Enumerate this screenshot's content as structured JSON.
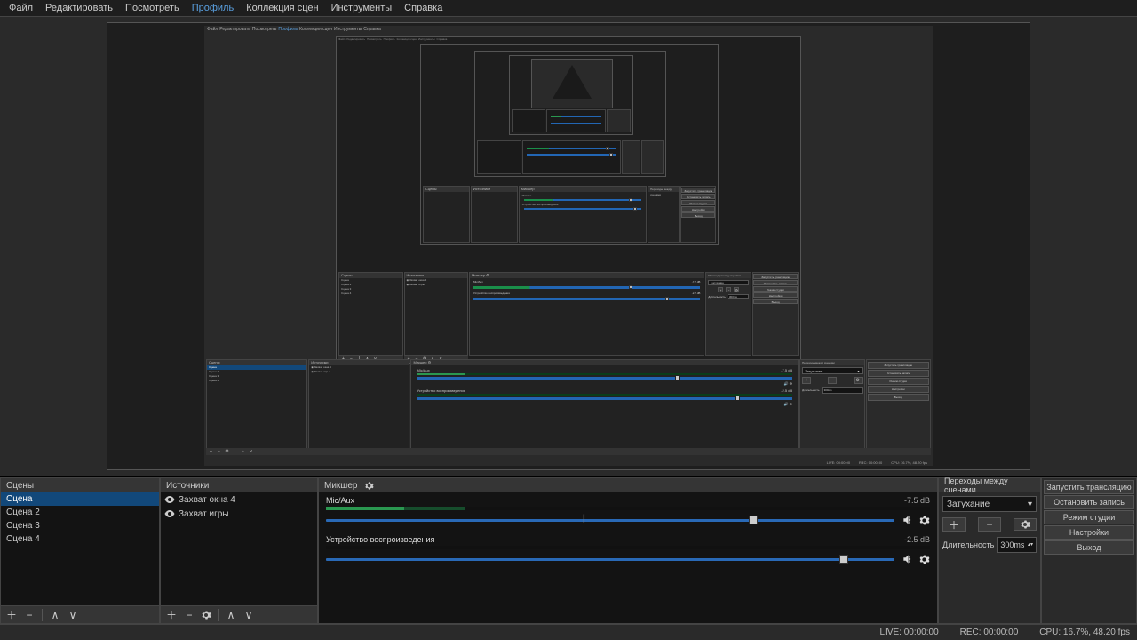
{
  "menu": {
    "file": "Файл",
    "edit": "Редактировать",
    "view": "Посмотреть",
    "profile": "Профиль",
    "scene_collection": "Коллекция сцен",
    "tools": "Инструменты",
    "help": "Справка"
  },
  "docks": {
    "scenes_title": "Сцены",
    "sources_title": "Источники",
    "mixer_title": "Микшер",
    "transitions_title": "Переходы между сценами"
  },
  "scenes": {
    "items": [
      "Сцена",
      "Сцена 2",
      "Сцена 3",
      "Сцена 4"
    ],
    "selected": 0
  },
  "sources": {
    "items": [
      {
        "name": "Захват окна 4",
        "visible": true
      },
      {
        "name": "Захват игры",
        "visible": true
      }
    ]
  },
  "mixer": {
    "channels": [
      {
        "name": "Mic/Aux",
        "db": "-7.5 dB",
        "meter_fill": 13,
        "meter_tail": 10,
        "knob_pct": 70
      },
      {
        "name": "Устройство воспроизведения",
        "db": "-2.5 dB",
        "meter_fill": 0,
        "meter_tail": 0,
        "knob_pct": 85
      }
    ]
  },
  "transitions": {
    "selected": "Затухание",
    "duration_label": "Длительность",
    "duration_value": "300ms"
  },
  "controls": {
    "start_stream": "Запустить трансляцию",
    "stop_record": "Остановить запись",
    "studio_mode": "Режим студии",
    "settings": "Настройки",
    "exit": "Выход"
  },
  "status": {
    "live": "LIVE: 00:00:00",
    "rec": "REC: 00:00:00",
    "cpu": "CPU: 16.7%, 48.20 fps"
  },
  "nested_status": {
    "live": "LIVE: 00:00:00",
    "rec": "REC: 00:00:00",
    "cpu": "CPU: 16.7%, 48.20 fps"
  },
  "icons": {
    "add": "＋",
    "remove": "−",
    "up": "∧",
    "down": "∨",
    "chev": "▾",
    "chev2": "▴▾"
  }
}
